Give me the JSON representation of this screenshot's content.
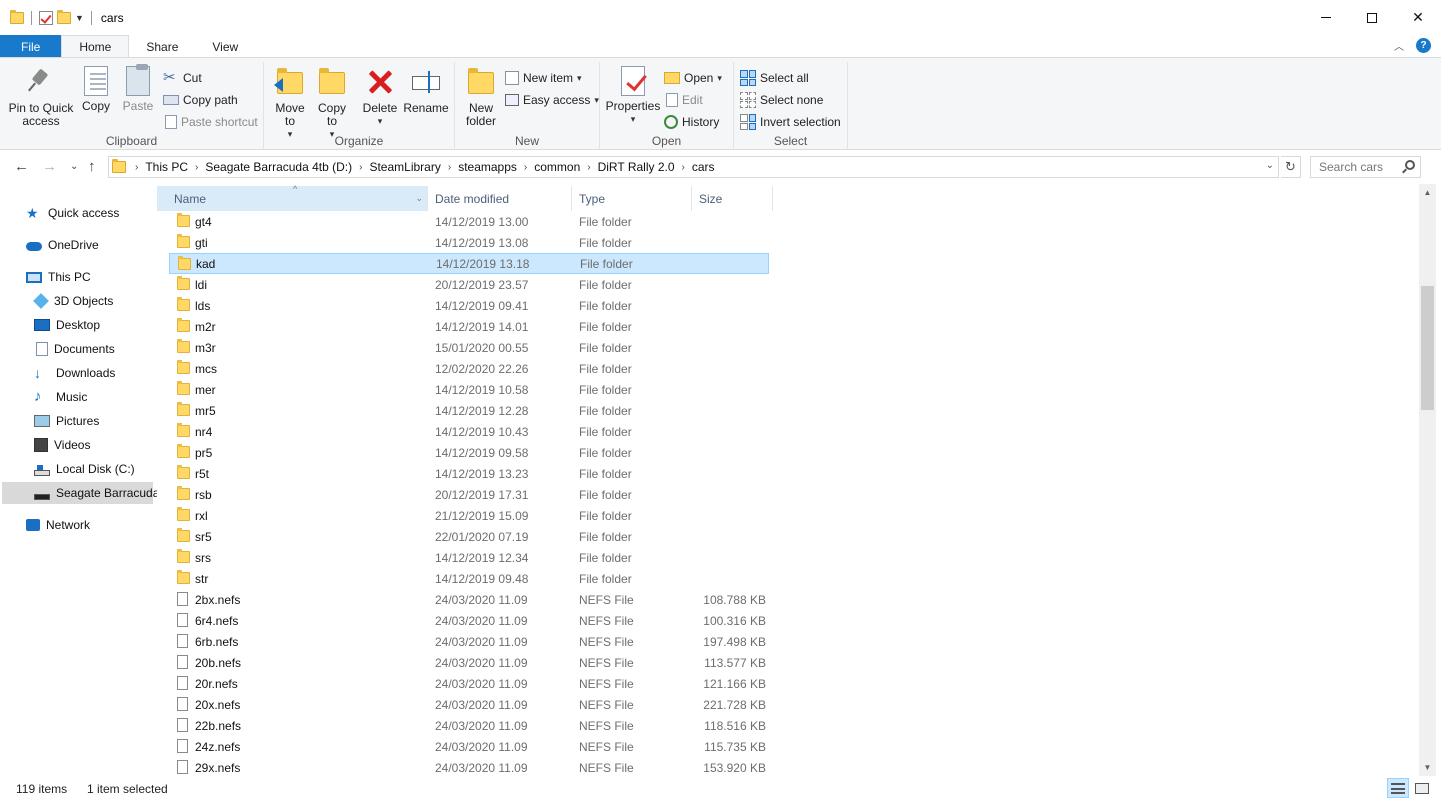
{
  "window": {
    "title": "cars",
    "minimize": "—",
    "close": "✕"
  },
  "ribbon_tabs": [
    "File",
    "Home",
    "Share",
    "View"
  ],
  "ribbon": {
    "clipboard": {
      "label": "Clipboard",
      "pin": "Pin to Quick access",
      "copy": "Copy",
      "paste": "Paste",
      "cut": "Cut",
      "copy_path": "Copy path",
      "paste_shortcut": "Paste shortcut"
    },
    "organize": {
      "label": "Organize",
      "move_to": "Move to",
      "copy_to": "Copy to",
      "delete": "Delete",
      "rename": "Rename"
    },
    "new": {
      "label": "New",
      "new_folder": "New folder",
      "new_item": "New item",
      "easy_access": "Easy access"
    },
    "open": {
      "label": "Open",
      "properties": "Properties",
      "open": "Open",
      "edit": "Edit",
      "history": "History"
    },
    "select": {
      "label": "Select",
      "select_all": "Select all",
      "select_none": "Select none",
      "invert_selection": "Invert selection"
    }
  },
  "address": {
    "breadcrumbs": [
      "This PC",
      "Seagate Barracuda 4tb (D:)",
      "SteamLibrary",
      "steamapps",
      "common",
      "DiRT Rally 2.0",
      "cars"
    ],
    "search_placeholder": "Search cars"
  },
  "nav": {
    "quick_access": "Quick access",
    "onedrive": "OneDrive",
    "this_pc": "This PC",
    "objects3d": "3D Objects",
    "desktop": "Desktop",
    "documents": "Documents",
    "downloads": "Downloads",
    "music": "Music",
    "pictures": "Pictures",
    "videos": "Videos",
    "local_disk": "Local Disk (C:)",
    "seagate": "Seagate Barracuda",
    "network": "Network"
  },
  "columns": {
    "name": "Name",
    "date": "Date modified",
    "type": "Type",
    "size": "Size"
  },
  "files": [
    {
      "name": "gt4",
      "date": "14/12/2019 13.00",
      "type": "File folder",
      "size": "",
      "kind": "folder"
    },
    {
      "name": "gti",
      "date": "14/12/2019 13.08",
      "type": "File folder",
      "size": "",
      "kind": "folder"
    },
    {
      "name": "kad",
      "date": "14/12/2019 13.18",
      "type": "File folder",
      "size": "",
      "kind": "folder",
      "selected": true
    },
    {
      "name": "ldi",
      "date": "20/12/2019 23.57",
      "type": "File folder",
      "size": "",
      "kind": "folder"
    },
    {
      "name": "lds",
      "date": "14/12/2019 09.41",
      "type": "File folder",
      "size": "",
      "kind": "folder"
    },
    {
      "name": "m2r",
      "date": "14/12/2019 14.01",
      "type": "File folder",
      "size": "",
      "kind": "folder"
    },
    {
      "name": "m3r",
      "date": "15/01/2020 00.55",
      "type": "File folder",
      "size": "",
      "kind": "folder"
    },
    {
      "name": "mcs",
      "date": "12/02/2020 22.26",
      "type": "File folder",
      "size": "",
      "kind": "folder"
    },
    {
      "name": "mer",
      "date": "14/12/2019 10.58",
      "type": "File folder",
      "size": "",
      "kind": "folder"
    },
    {
      "name": "mr5",
      "date": "14/12/2019 12.28",
      "type": "File folder",
      "size": "",
      "kind": "folder"
    },
    {
      "name": "nr4",
      "date": "14/12/2019 10.43",
      "type": "File folder",
      "size": "",
      "kind": "folder"
    },
    {
      "name": "pr5",
      "date": "14/12/2019 09.58",
      "type": "File folder",
      "size": "",
      "kind": "folder"
    },
    {
      "name": "r5t",
      "date": "14/12/2019 13.23",
      "type": "File folder",
      "size": "",
      "kind": "folder"
    },
    {
      "name": "rsb",
      "date": "20/12/2019 17.31",
      "type": "File folder",
      "size": "",
      "kind": "folder"
    },
    {
      "name": "rxl",
      "date": "21/12/2019 15.09",
      "type": "File folder",
      "size": "",
      "kind": "folder"
    },
    {
      "name": "sr5",
      "date": "22/01/2020 07.19",
      "type": "File folder",
      "size": "",
      "kind": "folder"
    },
    {
      "name": "srs",
      "date": "14/12/2019 12.34",
      "type": "File folder",
      "size": "",
      "kind": "folder"
    },
    {
      "name": "str",
      "date": "14/12/2019 09.48",
      "type": "File folder",
      "size": "",
      "kind": "folder"
    },
    {
      "name": "2bx.nefs",
      "date": "24/03/2020 11.09",
      "type": "NEFS File",
      "size": "108.788 KB",
      "kind": "file"
    },
    {
      "name": "6r4.nefs",
      "date": "24/03/2020 11.09",
      "type": "NEFS File",
      "size": "100.316 KB",
      "kind": "file"
    },
    {
      "name": "6rb.nefs",
      "date": "24/03/2020 11.09",
      "type": "NEFS File",
      "size": "197.498 KB",
      "kind": "file"
    },
    {
      "name": "20b.nefs",
      "date": "24/03/2020 11.09",
      "type": "NEFS File",
      "size": "113.577 KB",
      "kind": "file"
    },
    {
      "name": "20r.nefs",
      "date": "24/03/2020 11.09",
      "type": "NEFS File",
      "size": "121.166 KB",
      "kind": "file"
    },
    {
      "name": "20x.nefs",
      "date": "24/03/2020 11.09",
      "type": "NEFS File",
      "size": "221.728 KB",
      "kind": "file"
    },
    {
      "name": "22b.nefs",
      "date": "24/03/2020 11.09",
      "type": "NEFS File",
      "size": "118.516 KB",
      "kind": "file"
    },
    {
      "name": "24z.nefs",
      "date": "24/03/2020 11.09",
      "type": "NEFS File",
      "size": "115.735 KB",
      "kind": "file"
    },
    {
      "name": "29x.nefs",
      "date": "24/03/2020 11.09",
      "type": "NEFS File",
      "size": "153.920 KB",
      "kind": "file"
    }
  ],
  "status": {
    "count": "119 items",
    "selection": "1 item selected"
  }
}
